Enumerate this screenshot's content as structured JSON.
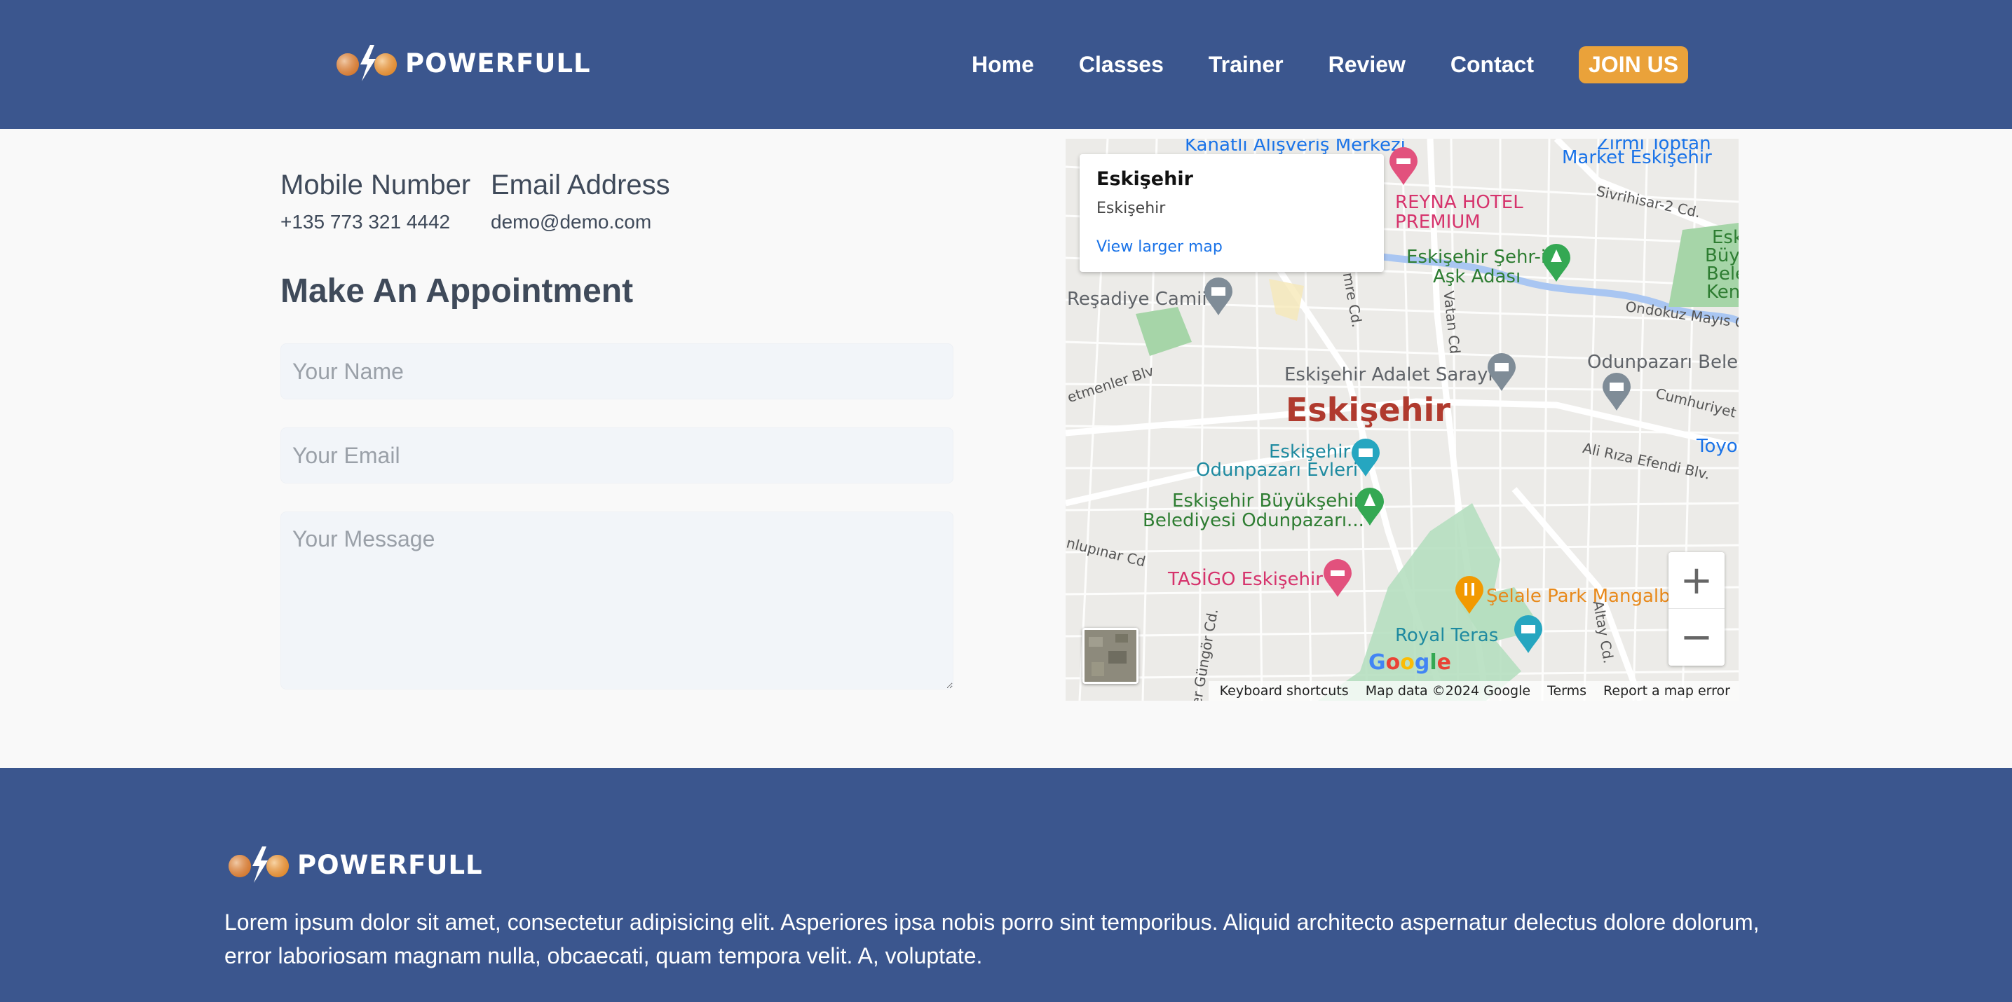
{
  "brand": {
    "name": "POWERFULL",
    "accent": "#eaa23a",
    "primary": "#3b568e"
  },
  "nav": {
    "items": [
      "Home",
      "Classes",
      "Trainer",
      "Review",
      "Contact"
    ],
    "cta": "JOIN US"
  },
  "contact": {
    "mobile_label": "Mobile Number",
    "mobile_value": "+135 773 321 4442",
    "email_label": "Email Address",
    "email_value": "demo@demo.com"
  },
  "appointment": {
    "title": "Make An Appointment",
    "name_placeholder": "Your Name",
    "email_placeholder": "Your Email",
    "message_placeholder": "Your Message"
  },
  "map": {
    "info_title": "Eskişehir",
    "info_subtitle": "Eskişehir",
    "info_link": "View larger map",
    "city_label": "Eskişehir",
    "places": {
      "p1": "Kanatlı Alışveriş Merkezi",
      "p2": "Zirmi Toptan",
      "p3": "Market Eskişehir",
      "p4": "REYNA HOTEL",
      "p5": "PREMIUM",
      "p6": "Eskişehir Şehr-i",
      "p7": "Aşk Adası",
      "p8": "Reşadiye Camii",
      "p9": "Eskişehir Adalet Sarayı",
      "p10": "Odunpazarı Beled",
      "p11": "Eskişehir",
      "p12": "Odunpazarı Evleri",
      "p13": "Eskişehir Büyükşehir",
      "p14": "Belediyesi Odunpazarı...",
      "p15": "TASİGO Eskişehir",
      "p16": "Şelale Park Mangalba",
      "p17": "Royal Teras",
      "p18": "Toyo",
      "p19": "Esk",
      "p20": "Büyü",
      "p21": "Bele",
      "p22": "Ken"
    },
    "streets": {
      "s1": "Sivrihisar-2 Cd.",
      "s2": "Ondokuz Mayıs Cd",
      "s3": "Cumhuriyet Blv.",
      "s4": "Ali Rıza Efendi Blv.",
      "s5": "Vatan Cd",
      "s6": "mre Cd.",
      "s7": "etmenler Blv",
      "s8": "nlupınar Cd",
      "s9": "er Güngör Cd.",
      "s10": "Altay Cd."
    },
    "zoom_in": "+",
    "zoom_out": "−",
    "google": [
      "G",
      "o",
      "o",
      "g",
      "l",
      "e"
    ],
    "google_colors": [
      "#4285f4",
      "#ea4335",
      "#fbbc05",
      "#4285f4",
      "#34a853",
      "#ea4335"
    ],
    "attribution": [
      "Keyboard shortcuts",
      "Map data ©2024 Google",
      "Terms",
      "Report a map error"
    ]
  },
  "footer": {
    "text": "Lorem ipsum dolor sit amet, consectetur adipisicing elit. Asperiores ipsa nobis porro sint temporibus. Aliquid architecto aspernatur delectus dolore dolorum, error laboriosam magnam nulla, obcaecati, quam tempora velit. A, voluptate."
  }
}
